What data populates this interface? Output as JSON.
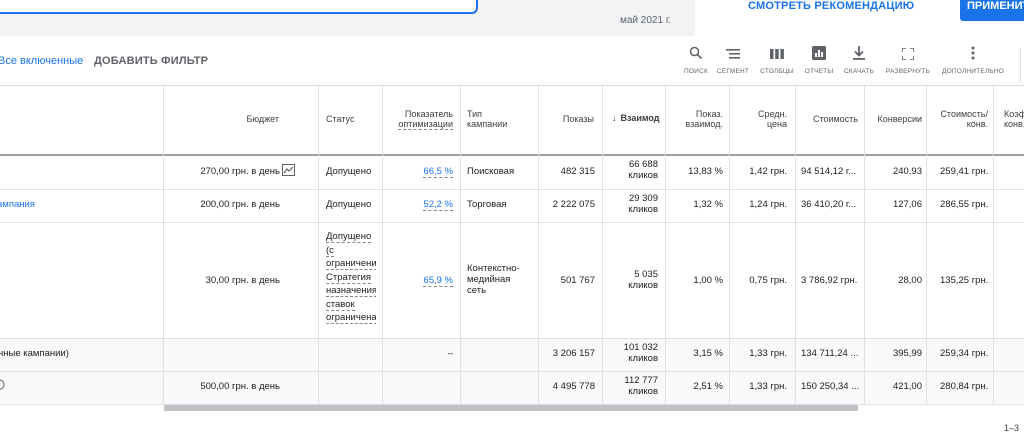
{
  "top": {
    "chart_date": "май 2021 г.",
    "view_recommendation": "СМОТРЕТЬ РЕКОМЕНДАЦИЮ",
    "apply": "ПРИМЕНИТЬ"
  },
  "filters": {
    "all_enabled": "Все включенные",
    "add_filter": "ДОБАВИТЬ ФИЛЬТР"
  },
  "toolbar": {
    "search": "ПОИСК",
    "segment": "СЕГМЕНТ",
    "columns": "СТОЛБЦЫ",
    "reports": "ОТЧЕТЫ",
    "download": "СКАЧАТЬ",
    "expand": "РАЗВЕРНУТЬ",
    "more": "ДОПОЛНИТЕЛЬНО"
  },
  "columns": {
    "budget": "Бюджет",
    "status": "Статус",
    "optimization_1": "Показатель",
    "optimization_2": "оптимизации",
    "type_1": "Тип",
    "type_2": "кампании",
    "impressions": "Показы",
    "interactions": "Взаимодействия",
    "interaction_rate_1": "Показ.",
    "interaction_rate_2": "взаимод.",
    "avg_cost_1": "Средн.",
    "avg_cost_2": "цена",
    "cost": "Стоимость",
    "conversions": "Конверсии",
    "cost_per_conv_1": "Стоимость/",
    "cost_per_conv_2": "конв.",
    "conv_rate_1": "Коэф.",
    "conv_rate_2": "конв."
  },
  "rows": [
    {
      "budget": "270,00 грн. в день",
      "status": "Допущено",
      "optimization": "66,5 %",
      "type": "Поисковая",
      "impressions": "482 315",
      "interactions": "66 688",
      "interactions_unit": "кликов",
      "interaction_rate": "13,83 %",
      "avg_cost": "1,42 грн.",
      "cost": "94 514,12 г...",
      "conversions": "240,93",
      "cost_per_conv": "259,41 грн."
    },
    {
      "name": "ампания",
      "budget": "200,00 грн. в день",
      "status": "Допущено",
      "optimization": "52,2 %",
      "type": "Торговая",
      "impressions": "2 222 075",
      "interactions": "29 309",
      "interactions_unit": "кликов",
      "interaction_rate": "1,32 %",
      "avg_cost": "1,24 грн.",
      "cost": "36 410,20 г...",
      "conversions": "127,06",
      "cost_per_conv": "286,55 грн."
    },
    {
      "budget": "30,00 грн. в день",
      "status_lines": [
        "Допущено",
        "(с",
        "ограничени",
        "Стратегия",
        "назначения",
        "ставок",
        "ограничена"
      ],
      "optimization": "65,9 %",
      "type_lines": [
        "Контекстно-",
        "медийная",
        "сеть"
      ],
      "impressions": "501 767",
      "interactions": "5 035",
      "interactions_unit": "кликов",
      "interaction_rate": "1,00 %",
      "avg_cost": "0,75 грн.",
      "cost": "3 786,92 грн.",
      "conversions": "28,00",
      "cost_per_conv": "135,25 грн."
    }
  ],
  "totals": [
    {
      "label": "нные кампании)",
      "optimization": "–",
      "impressions": "3 206 157",
      "interactions": "101 032",
      "interactions_unit": "кликов",
      "interaction_rate": "3,15 %",
      "avg_cost": "1,33 грн.",
      "cost": "134 711,24 ...",
      "conversions": "395,99",
      "cost_per_conv": "259,34 грн."
    },
    {
      "budget": "500,00 грн. в день",
      "impressions": "4 495 778",
      "interactions": "112 777",
      "interactions_unit": "кликов",
      "interaction_rate": "2,51 %",
      "avg_cost": "1,33 грн.",
      "cost": "150 250,34 ...",
      "conversions": "421,00",
      "cost_per_conv": "280,84 грн."
    }
  ],
  "pagination": {
    "range": "1–3"
  },
  "colors": {
    "accent": "#1a73e8",
    "text": "#202124",
    "muted": "#5f6368",
    "grid": "#e0e0e0",
    "total_row_bg": "#f8f9fa"
  }
}
